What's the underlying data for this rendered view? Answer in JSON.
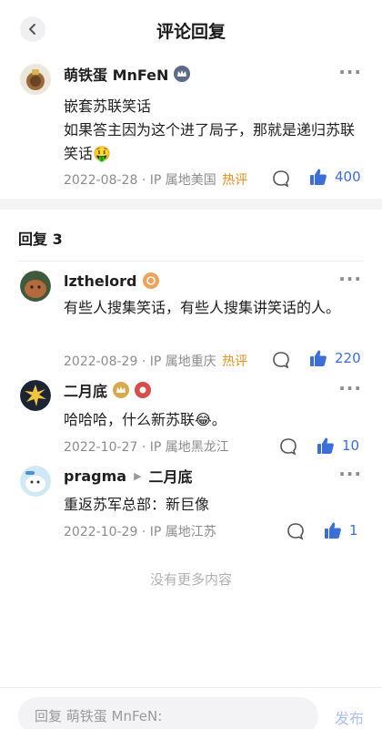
{
  "header": {
    "title": "评论回复"
  },
  "main_comment": {
    "author": "萌铁蛋 MnFeN",
    "content_line1": "嵌套苏联笑话",
    "content_line2": "如果答主因为这个进了局子，那就是递归苏联笑话",
    "emoji": "🤑",
    "date": "2022-08-28",
    "location": "IP 属地美国",
    "hot_label": "热评",
    "likes": "400"
  },
  "replies_section": {
    "title": "回复 3"
  },
  "replies": [
    {
      "author": "lzthelord",
      "content": "有些人搜集笑话，有些人搜集讲笑话的人。",
      "date": "2022-08-29",
      "location": "IP 属地重庆",
      "hot_label": "热评",
      "likes": "220"
    },
    {
      "author": "二月底",
      "content": "哈哈哈，什么新苏联",
      "emoji": "😂",
      "content_tail": "。",
      "date": "2022-10-27",
      "location": "IP 属地黑龙江",
      "likes": "10"
    },
    {
      "author": "pragma",
      "reply_to": "二月底",
      "content": "重返苏军总部：新巨像",
      "date": "2022-10-29",
      "location": "IP 属地江苏",
      "likes": "1"
    }
  ],
  "footer_text": "没有更多内容",
  "bottom_bar": {
    "input_placeholder": "回复 萌铁蛋 MnFeN:",
    "publish_label": "发布"
  },
  "colors": {
    "accent": "#3c6ed8",
    "hot": "#e88f1d",
    "publish_disabled": "#a9c0ee"
  },
  "icons": [
    "back-icon",
    "more-icon",
    "reply-bubble-icon",
    "thumbs-up-icon",
    "crown-badge-icon",
    "level-badge-icon"
  ]
}
